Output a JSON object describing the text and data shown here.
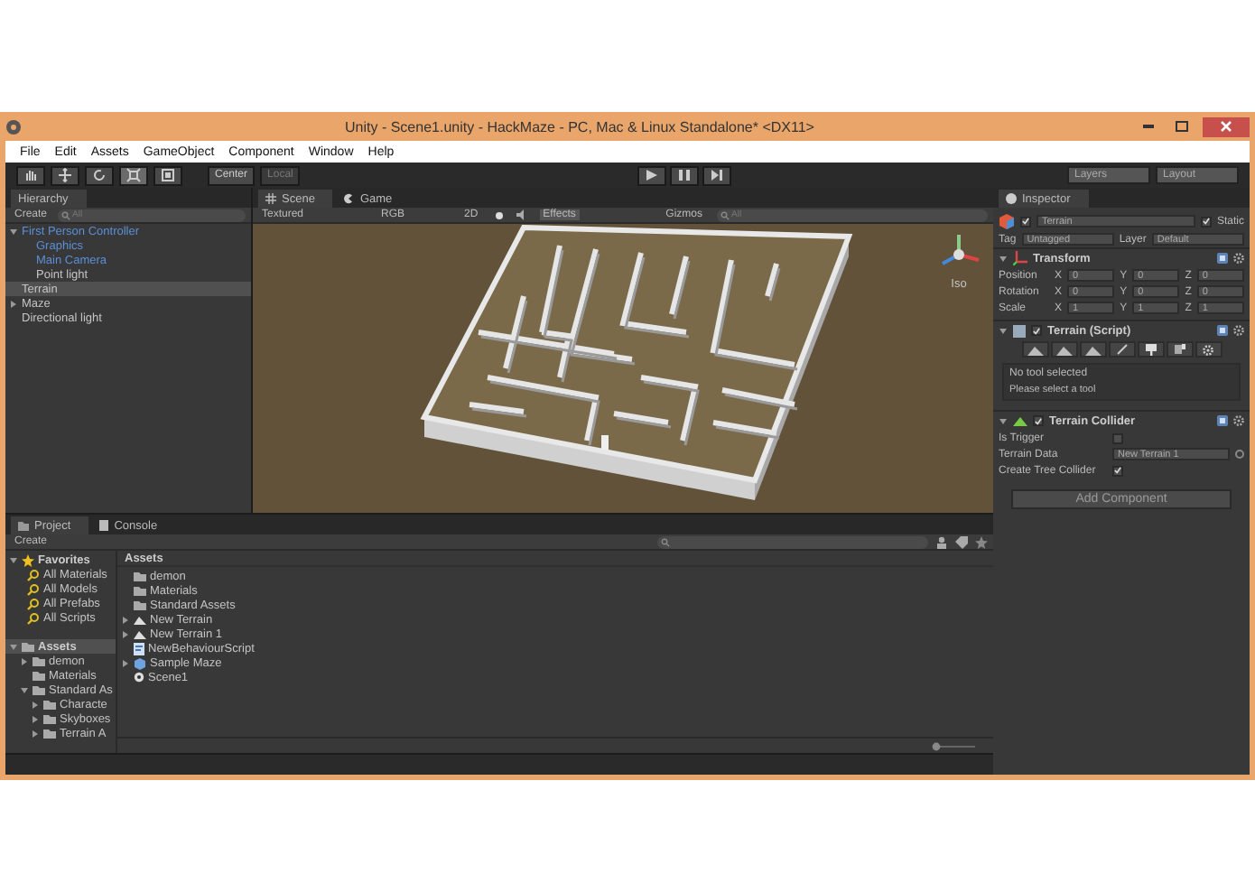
{
  "window": {
    "title": "Unity - Scene1.unity - HackMaze - PC, Mac & Linux Standalone* <DX11>"
  },
  "menu": [
    "File",
    "Edit",
    "Assets",
    "GameObject",
    "Component",
    "Window",
    "Help"
  ],
  "toolbar": {
    "tools": [
      {
        "kind": "hand",
        "selected": false
      },
      {
        "kind": "move",
        "selected": false
      },
      {
        "kind": "rotate",
        "selected": false
      },
      {
        "kind": "scale",
        "selected": true
      },
      {
        "kind": "rect",
        "selected": false
      }
    ],
    "pivot": [
      {
        "label": "Center",
        "selected": true
      },
      {
        "label": "Local",
        "selected": false
      }
    ],
    "layers": "Layers",
    "layout": "Layout"
  },
  "hierarchy": {
    "title": "Hierarchy",
    "create": "Create",
    "placeholder": "All",
    "items": [
      {
        "label": "First Person Controller",
        "kind": "prefab",
        "selected": false,
        "expanded": true,
        "children": [
          {
            "label": "Graphics",
            "kind": "prefab",
            "selected": false
          },
          {
            "label": "Main Camera",
            "kind": "prefab",
            "selected": false
          },
          {
            "label": "Point light",
            "kind": "object",
            "selected": false
          }
        ]
      },
      {
        "label": "Terrain",
        "kind": "object",
        "selected": true
      },
      {
        "label": "Maze",
        "kind": "object",
        "selected": false,
        "expanded": false
      },
      {
        "label": "Directional light",
        "kind": "object",
        "selected": false
      }
    ]
  },
  "scene": {
    "tabs": [
      {
        "label": "Scene",
        "kind": "scene",
        "selected": true
      },
      {
        "label": "Game",
        "kind": "game",
        "selected": false
      }
    ],
    "shading": "Textured",
    "mode": "RGB",
    "toggle_2d": "2D",
    "effects": "Effects",
    "gizmos": "Gizmos",
    "placeholder": "All",
    "view_label": "Iso"
  },
  "inspector": {
    "title": "Inspector",
    "name": "Terrain",
    "active": true,
    "static_label": "Static",
    "static": true,
    "tag_label": "Tag",
    "tag": "Untagged",
    "layer_label": "Layer",
    "layer": "Default",
    "transform": {
      "title": "Transform",
      "rows": [
        {
          "label": "Position",
          "fields": [
            {
              "axis": "X",
              "value": "0"
            },
            {
              "axis": "Y",
              "value": "0"
            },
            {
              "axis": "Z",
              "value": "0"
            }
          ]
        },
        {
          "label": "Rotation",
          "fields": [
            {
              "axis": "X",
              "value": "0"
            },
            {
              "axis": "Y",
              "value": "0"
            },
            {
              "axis": "Z",
              "value": "0"
            }
          ]
        },
        {
          "label": "Scale",
          "fields": [
            {
              "axis": "X",
              "value": "1"
            },
            {
              "axis": "Y",
              "value": "1"
            },
            {
              "axis": "Z",
              "value": "1"
            }
          ]
        }
      ]
    },
    "terrain_script": {
      "title": "Terrain (Script)",
      "enabled": true,
      "tools": [
        {
          "kind": "raise",
          "selected": false
        },
        {
          "kind": "paint-height",
          "selected": false
        },
        {
          "kind": "smooth",
          "selected": false
        },
        {
          "kind": "texture",
          "selected": false
        },
        {
          "kind": "tree",
          "selected": false
        },
        {
          "kind": "detail",
          "selected": false
        },
        {
          "kind": "settings",
          "selected": false
        }
      ],
      "message": "No tool selected",
      "hint": "Please select a tool"
    },
    "collider": {
      "title": "Terrain Collider",
      "enabled": true,
      "is_trigger_label": "Is Trigger",
      "is_trigger": false,
      "data_label": "Terrain Data",
      "data": "New Terrain 1",
      "tree_label": "Create Tree Collider",
      "tree": true
    },
    "add_button": "Add Component"
  },
  "project": {
    "tabs": [
      {
        "label": "Project",
        "kind": "project",
        "selected": true
      },
      {
        "label": "Console",
        "kind": "console",
        "selected": false
      }
    ],
    "create": "Create",
    "favorites": {
      "label": "Favorites",
      "expanded": true,
      "items": [
        "All Materials",
        "All Models",
        "All Prefabs",
        "All Scripts"
      ]
    },
    "tree": {
      "label": "Assets",
      "selected": true,
      "expanded": true,
      "children": [
        {
          "label": "demon",
          "expanded": false
        },
        {
          "label": "Materials"
        },
        {
          "label": "Standard As",
          "expanded": true,
          "children": [
            {
              "label": "Characte",
              "expanded": false
            },
            {
              "label": "Skyboxes",
              "expanded": false
            },
            {
              "label": "Terrain A",
              "expanded": false
            }
          ]
        }
      ]
    },
    "breadcrumb": "Assets",
    "assets": [
      {
        "label": "demon",
        "kind": "folder"
      },
      {
        "label": "Materials",
        "kind": "folder"
      },
      {
        "label": "Standard Assets",
        "kind": "folder"
      },
      {
        "label": "New Terrain",
        "kind": "terrain",
        "expandable": true
      },
      {
        "label": "New Terrain 1",
        "kind": "terrain",
        "expandable": true
      },
      {
        "label": "NewBehaviourScript",
        "kind": "script"
      },
      {
        "label": "Sample Maze",
        "kind": "prefab",
        "expandable": true
      },
      {
        "label": "Scene1",
        "kind": "scene"
      }
    ]
  }
}
